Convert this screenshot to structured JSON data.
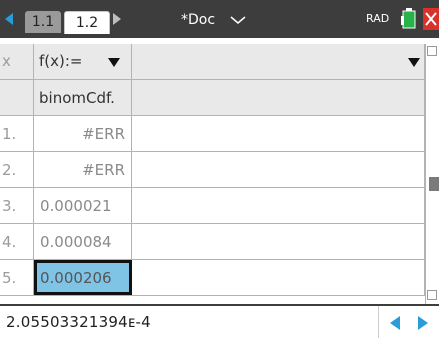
{
  "titlebar": {
    "tabs": [
      "1.1",
      "1.2"
    ],
    "doc_title": "*Doc",
    "mode": "RAD",
    "colors": {
      "bar": "#3d3d3d",
      "accent": "#2a9dd8",
      "close": "#d9322a",
      "battery": "#28b34a"
    },
    "icons": [
      "nav-left-arrow",
      "nav-right-arrow",
      "chevron-down-icon",
      "battery-icon",
      "close-icon"
    ]
  },
  "grid": {
    "header": {
      "col_label": "x",
      "formula_label": "f(x):="
    },
    "formula_row": {
      "value": "binomCdf."
    },
    "rows": [
      {
        "num": "1.",
        "value": "#ERR"
      },
      {
        "num": "2.",
        "value": "#ERR"
      },
      {
        "num": "3.",
        "value": "0.000021"
      },
      {
        "num": "4.",
        "value": "0.000084"
      },
      {
        "num": "5.",
        "value": "0.000206"
      }
    ],
    "selected_row": 5,
    "selected_color": "#7fc3e5"
  },
  "entry": {
    "text": "2.05503321394ᴇ-4"
  }
}
